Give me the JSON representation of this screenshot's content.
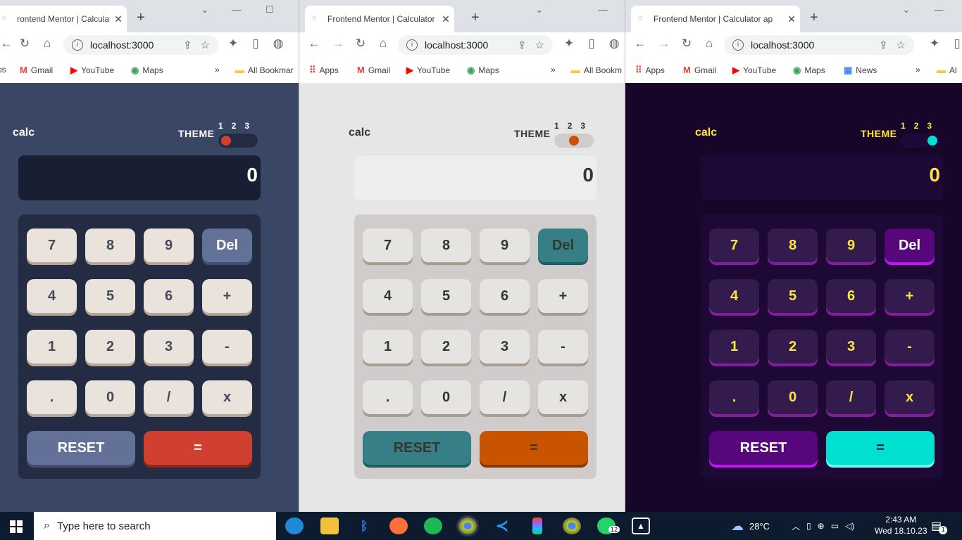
{
  "windows": [
    {
      "tab_title": "rontend Mentor | Calculator",
      "url": "localhost:3000",
      "bookmarks": [
        "ps",
        "Gmail",
        "YouTube",
        "Maps",
        "»",
        "All Bookmar"
      ],
      "calc": {
        "logo": "calc",
        "theme_label": "THEME",
        "theme_numbers": [
          "1",
          "2",
          "3"
        ],
        "display": "0",
        "keys": [
          "7",
          "8",
          "9",
          "Del",
          "4",
          "5",
          "6",
          "+",
          "1",
          "2",
          "3",
          "-",
          ".",
          "0",
          "/",
          "x"
        ],
        "reset": "RESET",
        "equals": "=",
        "active_theme": 1
      },
      "colors": {
        "bg": "#3a4764",
        "text": "#ffffff",
        "screen": "#181f32",
        "pad": "#232c43",
        "key": "#eae3dc",
        "key_text": "#434a59",
        "key_shadow": "#b4a597",
        "del": "#637097",
        "del_text": "#ffffff",
        "del_shadow": "#404e72",
        "eq": "#d03f2f",
        "eq_text": "#ffffff",
        "eq_shadow": "#93261a",
        "toggle": "#232c43",
        "knob": "#d03f2f",
        "logo": "#ffffff"
      }
    },
    {
      "tab_title": "Frontend Mentor | Calculator",
      "url": "localhost:3000",
      "bookmarks": [
        "Apps",
        "Gmail",
        "YouTube",
        "Maps",
        "»",
        "All Bookm"
      ],
      "calc": {
        "logo": "calc",
        "theme_label": "THEME",
        "theme_numbers": [
          "1",
          "2",
          "3"
        ],
        "display": "0",
        "keys": [
          "7",
          "8",
          "9",
          "Del",
          "4",
          "5",
          "6",
          "+",
          "1",
          "2",
          "3",
          "-",
          ".",
          "0",
          "/",
          "x"
        ],
        "reset": "RESET",
        "equals": "=",
        "active_theme": 2
      },
      "colors": {
        "bg": "#e6e6e6",
        "text": "#36362c",
        "screen": "#eeeeee",
        "pad": "#d1cccc",
        "key": "#e5e4e1",
        "key_text": "#36362c",
        "key_shadow": "#a69d91",
        "del": "#377f86",
        "del_text": "#36362c",
        "del_shadow": "#1b5f65",
        "eq": "#c85402",
        "eq_text": "#36362c",
        "eq_shadow": "#873901",
        "toggle": "#d1cccc",
        "knob": "#c85402",
        "logo": "#36362c"
      }
    },
    {
      "tab_title": "Frontend Mentor | Calculator ap",
      "url": "localhost:3000",
      "bookmarks": [
        "Apps",
        "Gmail",
        "YouTube",
        "Maps",
        "News",
        "»",
        "Al"
      ],
      "calc": {
        "logo": "calc",
        "theme_label": "THEME",
        "theme_numbers": [
          "1",
          "2",
          "3"
        ],
        "display": "0",
        "keys": [
          "7",
          "8",
          "9",
          "Del",
          "4",
          "5",
          "6",
          "+",
          "1",
          "2",
          "3",
          "-",
          ".",
          "0",
          "/",
          "x"
        ],
        "reset": "RESET",
        "equals": "=",
        "active_theme": 3
      },
      "colors": {
        "bg": "#17062a",
        "text": "#ffe53d",
        "screen": "#1e0836",
        "pad": "#1e0836",
        "key": "#331c4d",
        "key_text": "#ffe53d",
        "key_shadow": "#881c9e",
        "del": "#56077c",
        "del_text": "#ffffff",
        "del_shadow": "#be15f4",
        "eq": "#00e0d1",
        "eq_text": "#1a2327",
        "eq_shadow": "#6cf9f2",
        "toggle": "#1e0836",
        "knob": "#00e0d1",
        "logo": "#ffe53d"
      }
    }
  ],
  "taskbar": {
    "search_placeholder": "Type here to search",
    "weather": "28°C",
    "time": "2:43 AM",
    "date": "Wed 18.10.23",
    "whatsapp_badge": "12",
    "notification_count": "1"
  }
}
